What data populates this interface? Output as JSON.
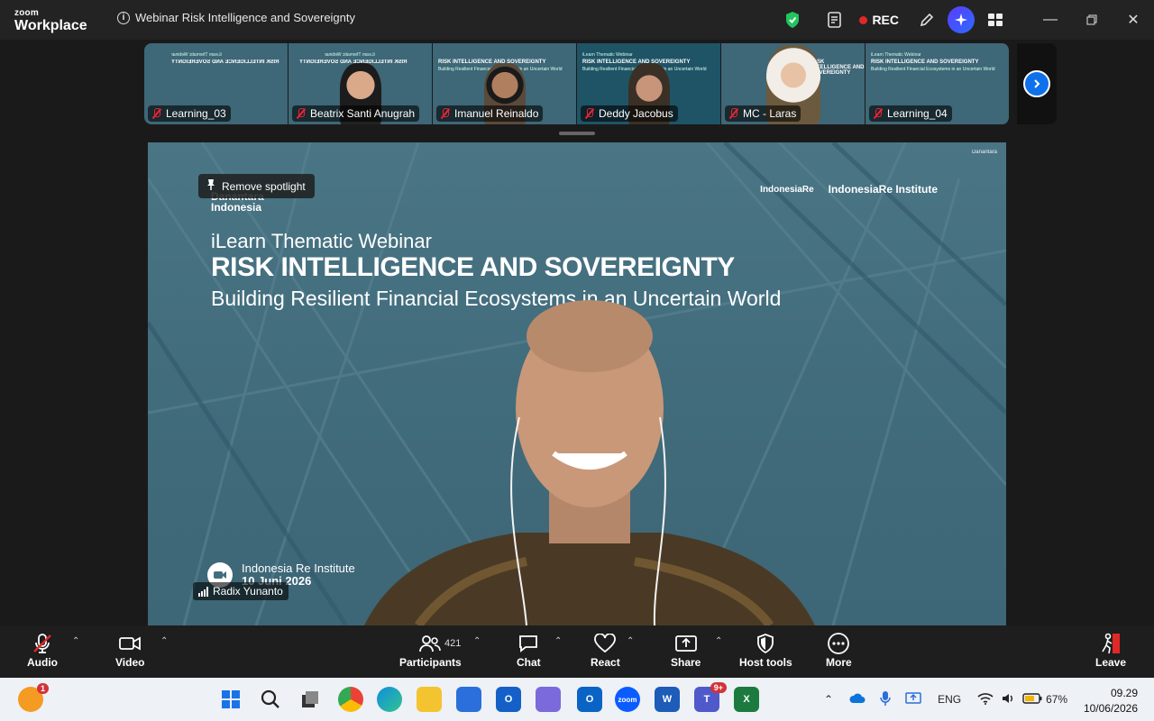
{
  "app": {
    "brand_line1": "zoom",
    "brand_line2": "Workplace"
  },
  "meeting": {
    "title": "Webinar Risk Intelligence and Sovereignty",
    "rec_label": "REC"
  },
  "thumbnails": [
    {
      "name": "Learning_03",
      "kind": "slide"
    },
    {
      "name": "Beatrix Santi Anugrah",
      "kind": "person"
    },
    {
      "name": "Imanuel Reinaldo",
      "kind": "person"
    },
    {
      "name": "Deddy Jacobus",
      "kind": "person"
    },
    {
      "name": "MC - Laras",
      "kind": "person"
    },
    {
      "name": "Learning_04",
      "kind": "slide"
    }
  ],
  "thumb_slide": {
    "line1": "iLearn Thematic Webinar",
    "line2": "RISK INTELLIGENCE AND SOVEREIGNTY",
    "line3": "Building Resilient Financial Ecosystems in an Uncertain World"
  },
  "main": {
    "spotlight_label": "Remove spotlight",
    "brand_left_1": "Danantara",
    "brand_left_2": "Indonesia",
    "slide_subtitle": "iLearn Thematic Webinar",
    "slide_title": "RISK INTELLIGENCE AND SOVEREIGNTY",
    "slide_tagline": "Building Resilient Financial Ecosystems in an Uncertain World",
    "logo_1": "IndonesiaRe",
    "logo_2": "IndonesiaRe Institute",
    "footer_org": "Indonesia Re Institute",
    "footer_date": "10 Juni 2026",
    "speaker_name": "Radix Yunanto"
  },
  "toolbar": {
    "audio": "Audio",
    "video": "Video",
    "participants": "Participants",
    "participants_count": "421",
    "chat": "Chat",
    "react": "React",
    "share": "Share",
    "host_tools": "Host tools",
    "more": "More",
    "leave": "Leave"
  },
  "taskbar": {
    "language": "ENG",
    "battery": "67%",
    "time": "09.29",
    "date": "10/06/2026",
    "teams_badge": "9+",
    "notif_badge": "1"
  },
  "colors": {
    "accent_blue": "#0e71eb",
    "rec_red": "#e02828",
    "slide_bg": "#426d7d"
  }
}
